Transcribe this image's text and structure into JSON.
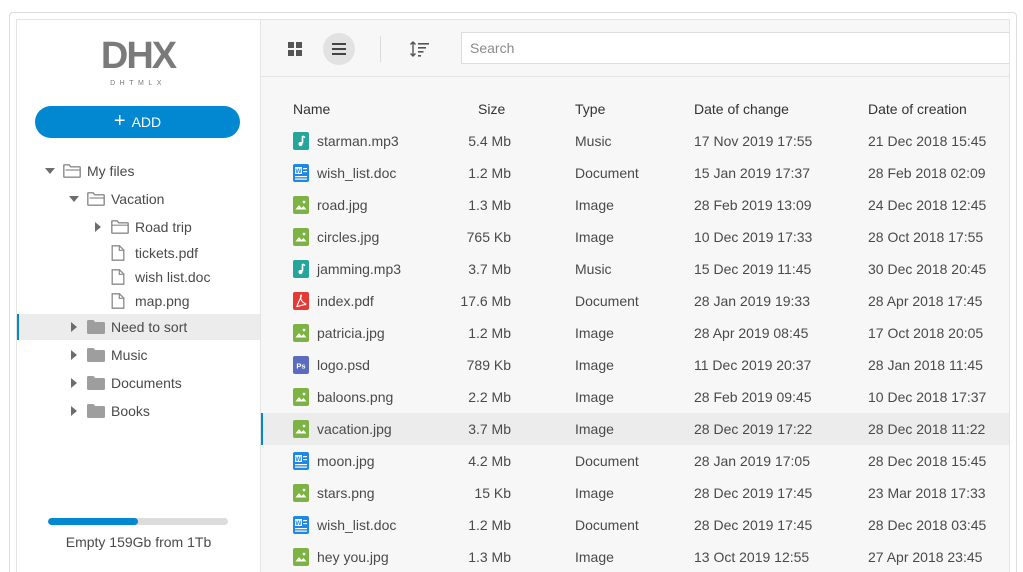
{
  "logo": {
    "text": "DHX",
    "sub": "DHTMLX"
  },
  "add_button": {
    "label": "ADD"
  },
  "tree": [
    {
      "label": "My files",
      "level": 0,
      "caret": "down",
      "icon": "folder-open-icon",
      "selected": false
    },
    {
      "label": "Vacation",
      "level": 1,
      "caret": "down",
      "icon": "folder-open-icon",
      "selected": false
    },
    {
      "label": "Road trip",
      "level": 2,
      "caret": "right",
      "icon": "folder-outline-icon",
      "selected": false
    },
    {
      "label": "tickets.pdf",
      "level": 2,
      "caret": "none",
      "icon": "file-icon",
      "selected": false
    },
    {
      "label": "wish list.doc",
      "level": 2,
      "caret": "none",
      "icon": "file-icon",
      "selected": false
    },
    {
      "label": "map.png",
      "level": 2,
      "caret": "none",
      "icon": "file-icon",
      "selected": false
    },
    {
      "label": "Need to sort",
      "level": 1,
      "caret": "right",
      "icon": "folder-icon",
      "selected": true
    },
    {
      "label": "Music",
      "level": 1,
      "caret": "right",
      "icon": "folder-icon",
      "selected": false
    },
    {
      "label": "Documents",
      "level": 1,
      "caret": "right",
      "icon": "folder-icon",
      "selected": false
    },
    {
      "label": "Books",
      "level": 1,
      "caret": "right",
      "icon": "folder-icon",
      "selected": false
    }
  ],
  "storage": {
    "text": "Empty 159Gb from 1Tb",
    "used_fraction": 0.5
  },
  "toolbar": {
    "search_placeholder": "Search"
  },
  "columns": [
    "Name",
    "Size",
    "Type",
    "Date of change",
    "Date of creation"
  ],
  "files": [
    {
      "name": "starman.mp3",
      "size": "5.4 Mb",
      "type": "Music",
      "changed": "17 Nov 2019 17:55",
      "created": "21 Dec 2018 15:45",
      "kind": "music",
      "selected": false
    },
    {
      "name": "wish_list.doc",
      "size": "1.2 Mb",
      "type": "Document",
      "changed": "15 Jan 2019 17:37",
      "created": "28 Feb 2018 02:09",
      "kind": "doc",
      "selected": false
    },
    {
      "name": "road.jpg",
      "size": "1.3 Mb",
      "type": "Image",
      "changed": "28 Feb 2019 13:09",
      "created": "24 Dec 2018 12:45",
      "kind": "image",
      "selected": false
    },
    {
      "name": "circles.jpg",
      "size": "765 Kb",
      "type": "Image",
      "changed": "10 Dec 2019 17:33",
      "created": "28 Oct 2018 17:55",
      "kind": "image",
      "selected": false
    },
    {
      "name": "jamming.mp3",
      "size": "3.7 Mb",
      "type": "Music",
      "changed": "15 Dec 2019 11:45",
      "created": "30 Dec 2018 20:45",
      "kind": "music",
      "selected": false
    },
    {
      "name": "index.pdf",
      "size": "17.6 Mb",
      "type": "Document",
      "changed": "28 Jan 2019 19:33",
      "created": "28 Apr 2018 17:45",
      "kind": "pdf",
      "selected": false
    },
    {
      "name": "patricia.jpg",
      "size": "1.2 Mb",
      "type": "Image",
      "changed": "28 Apr 2019 08:45",
      "created": "17 Oct 2018 20:05",
      "kind": "image",
      "selected": false
    },
    {
      "name": "logo.psd",
      "size": "789 Kb",
      "type": "Image",
      "changed": "11 Dec 2019 20:37",
      "created": "28 Jan 2018 11:45",
      "kind": "psd",
      "selected": false
    },
    {
      "name": "baloons.png",
      "size": "2.2 Mb",
      "type": "Image",
      "changed": "28 Feb 2019 09:45",
      "created": "10 Dec 2018 17:37",
      "kind": "image",
      "selected": false
    },
    {
      "name": "vacation.jpg",
      "size": "3.7 Mb",
      "type": "Image",
      "changed": "28 Dec 2019 17:22",
      "created": "28 Dec 2018 11:22",
      "kind": "image",
      "selected": true
    },
    {
      "name": "moon.jpg",
      "size": "4.2 Mb",
      "type": "Document",
      "changed": "28 Jan 2019 17:05",
      "created": "28 Dec 2018 15:45",
      "kind": "doc",
      "selected": false
    },
    {
      "name": "stars.png",
      "size": "15 Kb",
      "type": "Image",
      "changed": "28 Dec 2019 17:45",
      "created": "23 Mar 2018 17:33",
      "kind": "image",
      "selected": false
    },
    {
      "name": "wish_list.doc",
      "size": "1.2 Mb",
      "type": "Document",
      "changed": "28 Dec 2019 17:45",
      "created": "28 Dec 2018 03:45",
      "kind": "doc",
      "selected": false
    },
    {
      "name": "hey you.jpg",
      "size": "1.3 Mb",
      "type": "Image",
      "changed": "13 Oct 2019 12:55",
      "created": "27 Apr 2018 23:45",
      "kind": "image",
      "selected": false
    }
  ],
  "colors": {
    "accent": "#0288d1",
    "music": "#26a69a",
    "doc": "#1e88e5",
    "image": "#7cb342",
    "pdf": "#e53935",
    "psd": "#5c6bc0"
  }
}
